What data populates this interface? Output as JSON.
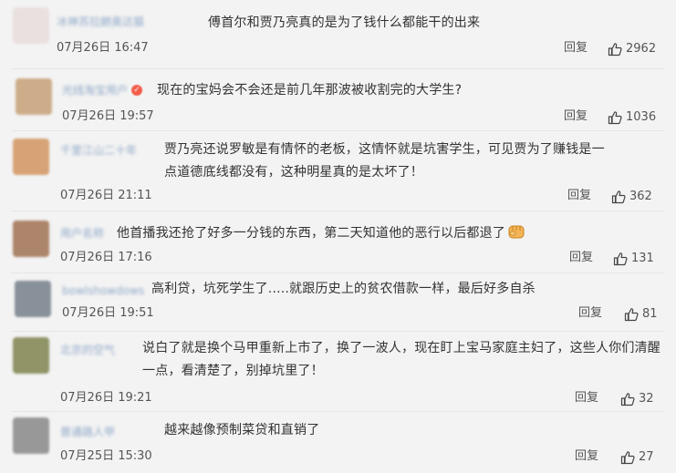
{
  "comments": [
    {
      "username": "冰神苏拉朗奥达猫",
      "text": "傅首尔和贾乃亮真的是为了钱什么都能干的出来",
      "time": "07月26日 16:47",
      "reply_label": "回复",
      "likes": "2962",
      "avatar_color": "#e7dcdc"
    },
    {
      "username": "光线淘宝用户",
      "text": "现在的宝妈会不会还是前几年那波被收割完的大学生?",
      "time": "07月26日 19:57",
      "reply_label": "回复",
      "likes": "1036",
      "avatar_color": "#c9a57e"
    },
    {
      "username": "千里江山二十年",
      "text": "贾乃亮还说罗敏是有情怀的老板，这情怀就是坑害学生，可见贾为了赚钱是一点道德底线都没有，这种明星真的是太坏了！",
      "time": "07月26日 21:11",
      "reply_label": "回复",
      "likes": "362",
      "avatar_color": "#d49a68"
    },
    {
      "username": "用户名称",
      "text": "他首播我还抢了好多一分钱的东西，第二天知道他的恶行以后都退了",
      "time": "07月26日 17:16",
      "reply_label": "回复",
      "likes": "131",
      "avatar_color": "#a57a5c"
    },
    {
      "username": "bowlshowdows",
      "text": "高利贷，坑死学生了.....就跟历史上的贫农借款一样，最后好多自杀",
      "time": "07月26日 19:51",
      "reply_label": "回复",
      "likes": "81",
      "avatar_color": "#7d8790"
    },
    {
      "username": "北京的空气",
      "text": "说白了就是换个马甲重新上市了，换了一波人，现在盯上宝马家庭主妇了，这些人你们清醒一点，看清楚了，别掉坑里了！",
      "time": "07月26日 19:21",
      "reply_label": "回复",
      "likes": "32",
      "avatar_color": "#868a58"
    },
    {
      "username": "普通路人甲",
      "text": "越来越像预制菜贷和直销了",
      "time": "07月25日 15:30",
      "reply_label": "回复",
      "likes": "27",
      "avatar_color": "#8f8f8f"
    }
  ],
  "colors": {
    "background": "#f3f3f3",
    "username": "#8fa8c8",
    "text": "#333333",
    "meta": "#555555",
    "badge": "#f25d4a"
  },
  "icons": {
    "like": "thumbs-up-outline-icon",
    "emoji": "fist-emoji-icon",
    "badge": "verified-badge-icon"
  }
}
